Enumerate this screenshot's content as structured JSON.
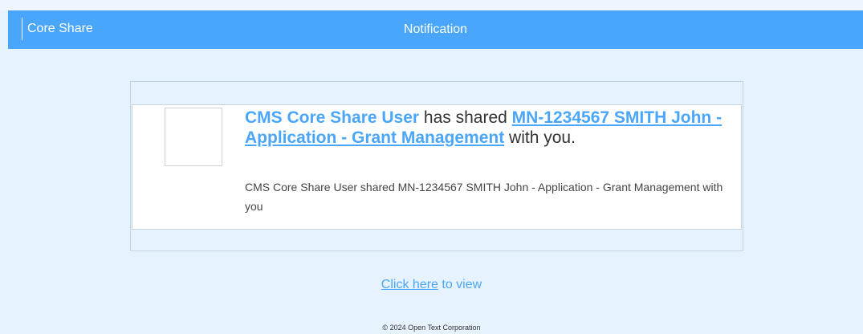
{
  "header": {
    "brand": "Core Share",
    "title": "Notification"
  },
  "notification": {
    "actor": "CMS Core Share User",
    "verb": "has shared",
    "document_title": "MN-1234567 SMITH John - Application - Grant Management",
    "suffix": "with you.",
    "description": "CMS Core Share User shared MN-1234567 SMITH John - Application - Grant Management with you"
  },
  "cta": {
    "link_label": "Click here",
    "trailing_text": "to view"
  },
  "footer": {
    "copyright": "© 2024 Open Text Corporation"
  },
  "colors": {
    "accent": "#4aa6fb",
    "background": "#e6f2fd",
    "card_border": "#c3d4e4"
  }
}
